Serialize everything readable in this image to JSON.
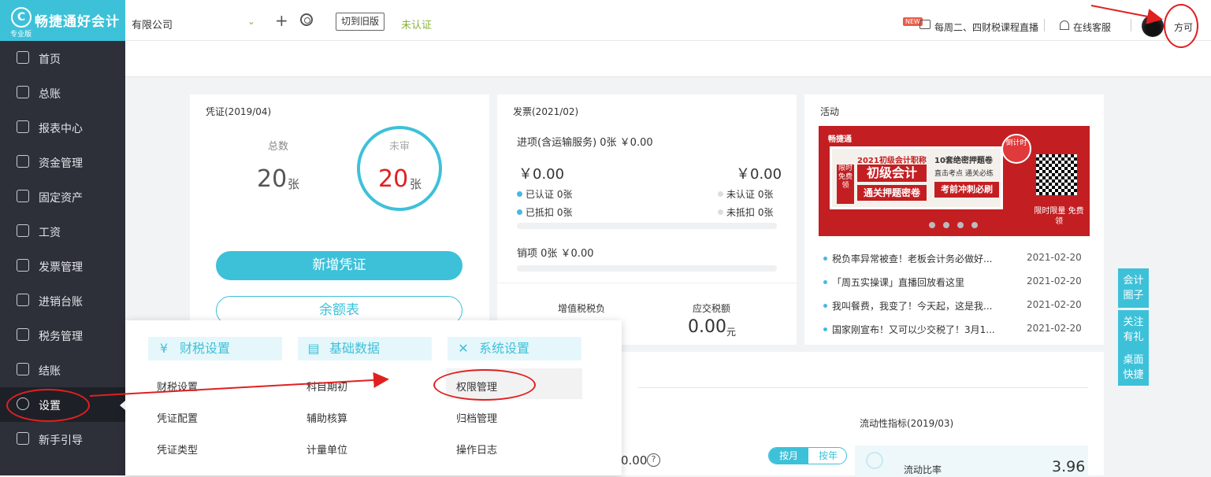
{
  "app": {
    "logo_name": "畅捷通好会计",
    "logo_badge": "专业版",
    "logo_glyph": "C"
  },
  "topbar": {
    "company": "有限公司",
    "switch_old": "切到旧版",
    "uncertified": "未认证",
    "new_badge": "NEW",
    "live_course": "每周二、四财税课程直播",
    "customer_service": "在线客服",
    "username": "方可"
  },
  "sidebar": {
    "items": [
      {
        "label": "首页",
        "icon": "home-icon"
      },
      {
        "label": "总账",
        "icon": "ledger-icon"
      },
      {
        "label": "报表中心",
        "icon": "report-icon"
      },
      {
        "label": "资金管理",
        "icon": "fund-icon"
      },
      {
        "label": "固定资产",
        "icon": "asset-icon"
      },
      {
        "label": "工资",
        "icon": "salary-icon"
      },
      {
        "label": "发票管理",
        "icon": "invoice-icon"
      },
      {
        "label": "进销台账",
        "icon": "stock-icon"
      },
      {
        "label": "税务管理",
        "icon": "tax-icon"
      },
      {
        "label": "结账",
        "icon": "closing-icon"
      },
      {
        "label": "设置",
        "icon": "gear-icon"
      },
      {
        "label": "新手引导",
        "icon": "guide-icon"
      }
    ]
  },
  "voucher": {
    "title": "凭证(2019/04)",
    "total_label": "总数",
    "total": "20",
    "total_unit": "张",
    "unreviewed_label": "未审",
    "unreviewed": "20",
    "unreviewed_unit": "张",
    "add_button": "新增凭证",
    "balance_button": "余额表"
  },
  "invoice": {
    "title": "发票(2021/02)",
    "input_label": "进项(含运输服务) 0张 ￥0.00",
    "amount_left": "￥0.00",
    "amount_right": "￥0.00",
    "certified": "已认证  0张",
    "uncertified": "未认证  0张",
    "deducted": "已抵扣  0张",
    "undeducted": "未抵扣  0张",
    "output_label": "销项   0张   ￥0.00",
    "vat_burden_label": "增值税税负",
    "tax_due_label": "应交税额",
    "tax_due": "0.00",
    "tax_due_unit": "元"
  },
  "activity": {
    "title": "活动",
    "banner": {
      "brand": "畅捷通",
      "side": "限时免费领",
      "subtitle": "2021初级会计职称",
      "big1": "初级会计",
      "big2": "通关押题密卷",
      "r1": "10套绝密押题卷",
      "r2": "直击考点 通关必练",
      "r3": "考前冲刺必刷",
      "seal": "倒计时",
      "limit": "限时限量 免费领"
    },
    "news": [
      {
        "text": "税负率异常被查！老板会计务必做好...",
        "date": "2021-02-20"
      },
      {
        "text": "「周五实操课」直播回放看这里",
        "date": "2021-02-20"
      },
      {
        "text": "我叫餐费，我变了！今天起，这是我...",
        "date": "2021-02-20"
      },
      {
        "text": "国家刚宣布！又可以少交税了！3月1...",
        "date": "2021-02-20"
      }
    ]
  },
  "floats": [
    "会计圈子",
    "关注有礼",
    "桌面快捷"
  ],
  "dropdown": {
    "groups": [
      {
        "title": "财税设置",
        "icon": "tax-setting-icon",
        "items": [
          "财税设置",
          "凭证配置",
          "凭证类型"
        ]
      },
      {
        "title": "基础数据",
        "icon": "base-data-icon",
        "items": [
          "科目期初",
          "辅助核算",
          "计量单位"
        ]
      },
      {
        "title": "系统设置",
        "icon": "system-setting-icon",
        "items": [
          "权限管理",
          "归档管理",
          "操作日志"
        ]
      }
    ]
  },
  "bottom": {
    "value": "0.00",
    "qmark": "?",
    "by_month": "按月",
    "by_year": "按年",
    "liquidity_title": "流动性指标(2019/03)",
    "current_ratio_label": "流动比率",
    "current_ratio": "3.96"
  },
  "colors": {
    "accent": "#3dc1d9",
    "sidebar": "#2d3039",
    "danger": "#e02020",
    "green": "#8ab23b"
  }
}
